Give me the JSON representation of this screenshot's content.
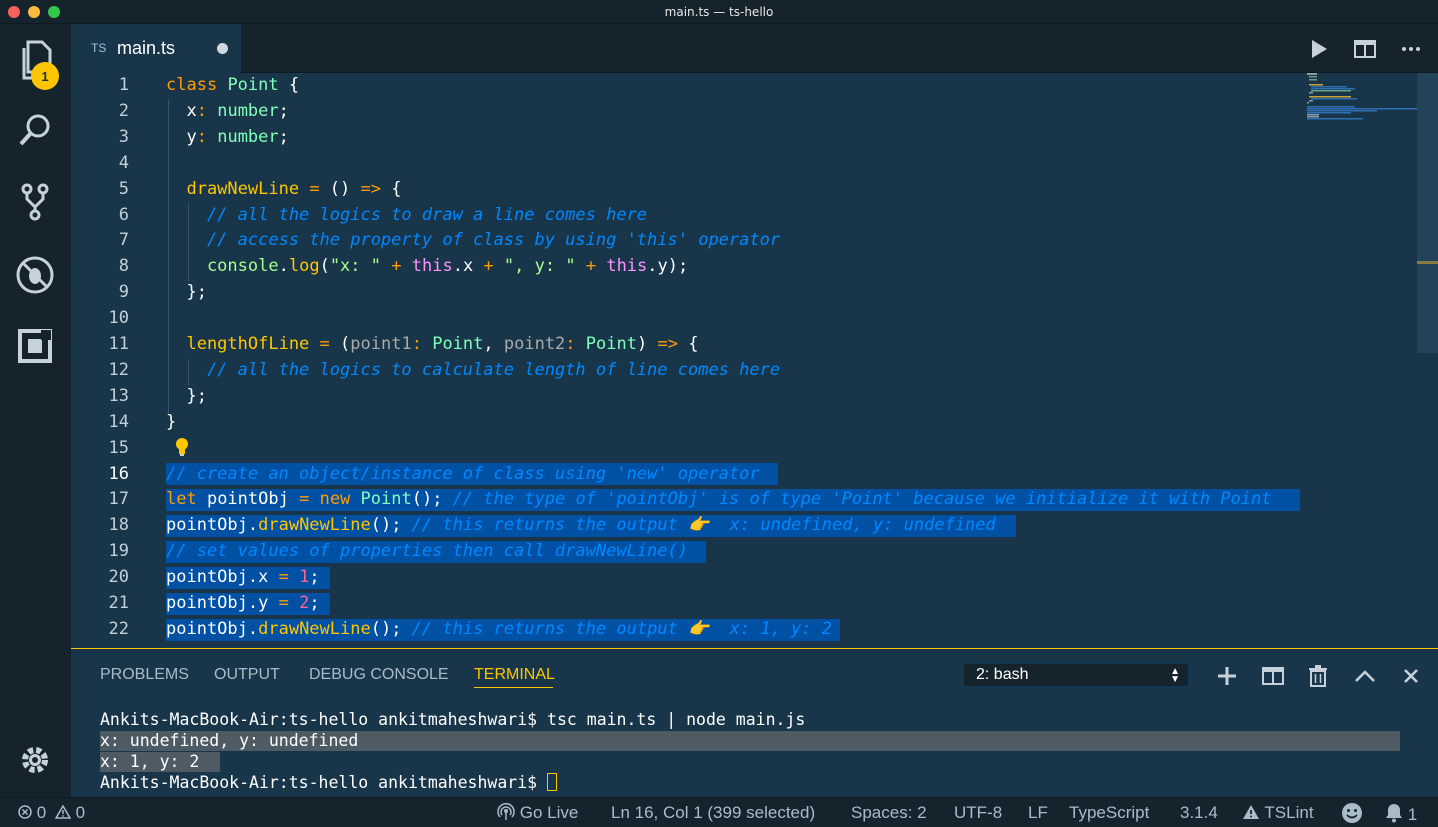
{
  "window": {
    "title": "main.ts — ts-hello"
  },
  "activity": {
    "explorer_badge": "1"
  },
  "tabs": [
    {
      "icon": "TS",
      "label": "main.ts"
    }
  ],
  "editor": {
    "line_numbers": [
      "1",
      "2",
      "3",
      "4",
      "5",
      "6",
      "7",
      "8",
      "9",
      "10",
      "11",
      "12",
      "13",
      "14",
      "15",
      "16",
      "17",
      "18",
      "19",
      "20",
      "21",
      "22"
    ],
    "lines": [
      [
        [
          "kw",
          "class"
        ],
        [
          "pun",
          " "
        ],
        [
          "cls",
          "Point"
        ],
        [
          "pun",
          " {"
        ]
      ],
      [
        [
          "pun",
          "  x"
        ],
        [
          "op",
          ":"
        ],
        [
          "pun",
          " "
        ],
        [
          "cls",
          "number"
        ],
        [
          "pun",
          ";"
        ]
      ],
      [
        [
          "pun",
          "  y"
        ],
        [
          "op",
          ":"
        ],
        [
          "pun",
          " "
        ],
        [
          "cls",
          "number"
        ],
        [
          "pun",
          ";"
        ]
      ],
      [],
      [
        [
          "fn",
          "  drawNewLine"
        ],
        [
          "pun",
          " "
        ],
        [
          "op",
          "="
        ],
        [
          "pun",
          " () "
        ],
        [
          "op",
          "=>"
        ],
        [
          "pun",
          " {"
        ]
      ],
      [
        [
          "cm",
          "    // all the logics to draw a line comes here"
        ]
      ],
      [
        [
          "cm",
          "    // access the property of class by using 'this' operator"
        ]
      ],
      [
        [
          "str",
          "    console"
        ],
        [
          "pun",
          "."
        ],
        [
          "fn",
          "log"
        ],
        [
          "pun",
          "("
        ],
        [
          "str",
          "\"x: \""
        ],
        [
          "pun",
          " "
        ],
        [
          "op",
          "+"
        ],
        [
          "pun",
          " "
        ],
        [
          "this",
          "this"
        ],
        [
          "pun",
          ".x "
        ],
        [
          "op",
          "+"
        ],
        [
          "pun",
          " "
        ],
        [
          "str",
          "\", y: \""
        ],
        [
          "pun",
          " "
        ],
        [
          "op",
          "+"
        ],
        [
          "pun",
          " "
        ],
        [
          "this",
          "this"
        ],
        [
          "pun",
          ".y);"
        ]
      ],
      [
        [
          "pun",
          "  };"
        ]
      ],
      [],
      [
        [
          "fn",
          "  lengthOfLine"
        ],
        [
          "pun",
          " "
        ],
        [
          "op",
          "="
        ],
        [
          "pun",
          " ("
        ],
        [
          "param",
          "point1"
        ],
        [
          "op",
          ":"
        ],
        [
          "pun",
          " "
        ],
        [
          "cls",
          "Point"
        ],
        [
          "pun",
          ", "
        ],
        [
          "param",
          "point2"
        ],
        [
          "op",
          ":"
        ],
        [
          "pun",
          " "
        ],
        [
          "cls",
          "Point"
        ],
        [
          "pun",
          ") "
        ],
        [
          "op",
          "=>"
        ],
        [
          "pun",
          " {"
        ]
      ],
      [
        [
          "cm",
          "    // all the logics to calculate length of line comes here"
        ]
      ],
      [
        [
          "pun",
          "  };"
        ]
      ],
      [
        [
          "pun",
          "}"
        ]
      ],
      [],
      [
        [
          "cm",
          "// create an object/instance of class using 'new' operator"
        ]
      ],
      [
        [
          "kw",
          "let"
        ],
        [
          "pun",
          " pointObj "
        ],
        [
          "op",
          "="
        ],
        [
          "pun",
          " "
        ],
        [
          "kw",
          "new"
        ],
        [
          "pun",
          " "
        ],
        [
          "cls",
          "Point"
        ],
        [
          "pun",
          "(); "
        ],
        [
          "cm",
          "// the type of 'pointObj' is of type 'Point' because we initialize it with Point"
        ]
      ],
      [
        [
          "pun",
          "pointObj."
        ],
        [
          "fn",
          "drawNewLine"
        ],
        [
          "pun",
          "(); "
        ],
        [
          "cm",
          "// this returns the output 👉  x: undefined, y: undefined"
        ]
      ],
      [
        [
          "cm",
          "// set values of properties then call drawNewLine()"
        ]
      ],
      [
        [
          "pun",
          "pointObj.x "
        ],
        [
          "op",
          "="
        ],
        [
          "pun",
          " "
        ],
        [
          "num",
          "1"
        ],
        [
          "pun",
          ";"
        ]
      ],
      [
        [
          "pun",
          "pointObj.y "
        ],
        [
          "op",
          "="
        ],
        [
          "pun",
          " "
        ],
        [
          "num",
          "2"
        ],
        [
          "pun",
          ";"
        ]
      ],
      [
        [
          "pun",
          "pointObj."
        ],
        [
          "fn",
          "drawNewLine"
        ],
        [
          "pun",
          "(); "
        ],
        [
          "cm",
          "// this returns the output 👉  x: 1, y: 2"
        ]
      ]
    ]
  },
  "panel": {
    "tabs": [
      "PROBLEMS",
      "OUTPUT",
      "DEBUG CONSOLE",
      "TERMINAL"
    ],
    "active_tab": "TERMINAL",
    "terminal_select": "2: bash",
    "terminal_lines": [
      "Ankits-MacBook-Air:ts-hello ankitmaheshwari$ tsc main.ts | node main.js",
      "x: undefined, y: undefined",
      "x: 1, y: 2",
      "Ankits-MacBook-Air:ts-hello ankitmaheshwari$ "
    ]
  },
  "statusbar": {
    "errors": "0",
    "warnings": "0",
    "go_live": "Go Live",
    "cursor_position": "Ln 16, Col 1 (399 selected)",
    "spaces": "Spaces: 2",
    "encoding": "UTF-8",
    "eol": "LF",
    "language": "TypeScript",
    "ts_version": "3.1.4",
    "tslint": "TSLint",
    "notifications": "1"
  },
  "colors": {
    "background": "#193549",
    "chrome": "#15232d",
    "accent": "#ffc600",
    "selection": "#0050a4"
  },
  "icons": [
    "files-icon",
    "search-icon",
    "source-control-icon",
    "debug-icon",
    "extensions-icon",
    "gear-icon",
    "run-icon",
    "split-editor-icon",
    "more-icon",
    "add-terminal-icon",
    "split-terminal-icon",
    "trash-icon",
    "maximize-panel-icon",
    "close-panel-icon",
    "error-icon",
    "warning-icon",
    "broadcast-icon",
    "smiley-icon",
    "bell-icon"
  ]
}
